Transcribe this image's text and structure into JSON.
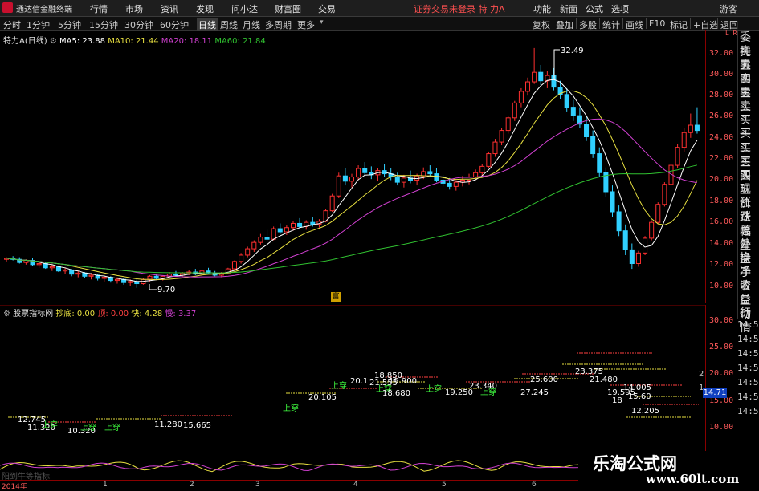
{
  "menubar": {
    "app_title": "通达信金融终端",
    "items": [
      "行情",
      "市场",
      "资讯",
      "发现",
      "问小达",
      "财富圈",
      "交易"
    ],
    "login_status": "证券交易未登录 特 力A",
    "right_items": [
      "功能",
      "新面",
      "公式",
      "选项"
    ],
    "guest": "游客"
  },
  "toolbar": {
    "periods": [
      "分时",
      "1分钟",
      "5分钟",
      "15分钟",
      "30分钟",
      "60分钟",
      "日线",
      "周线",
      "月线",
      "多周期",
      "更多"
    ],
    "active_period": "日线",
    "right_items": [
      "复权",
      "叠加",
      "多股",
      "统计",
      "画线",
      "F10",
      "标记",
      "+自选",
      "返回"
    ]
  },
  "main_legend": {
    "name": "特力A(日线)",
    "ma5": "MA5: 23.88",
    "ma10": "MA10: 21.44",
    "ma20": "MA20: 18.11",
    "ma60": "MA60: 21.84"
  },
  "main_annotations": {
    "high": "32.49",
    "low": "9.70",
    "fuq": "富"
  },
  "ind_legend": {
    "name": "股票指标网",
    "chaodi": "抄底: 0.00",
    "ding": "顶: 0.00",
    "kuai": "快: 4.28",
    "man": "慢: 3.37"
  },
  "ind_annotations": [
    {
      "t": "12.745",
      "c": "#ffffff"
    },
    {
      "t": "11.320",
      "c": "#ffffff"
    },
    {
      "t": "10.320",
      "c": "#ffffff"
    },
    {
      "t": "上穿",
      "c": "#40ff40"
    },
    {
      "t": "上穿",
      "c": "#40ff40"
    },
    {
      "t": "上穿",
      "c": "#40ff40"
    },
    {
      "t": "11.280",
      "c": "#ffffff"
    },
    {
      "t": "15.665",
      "c": "#ffffff"
    },
    {
      "t": "上穿",
      "c": "#40ff40"
    },
    {
      "t": "20.105",
      "c": "#ffffff"
    },
    {
      "t": "上穿",
      "c": "#40ff40"
    },
    {
      "t": "20.1",
      "c": "#ffffff"
    },
    {
      "t": "21.555",
      "c": "#ffffff"
    },
    {
      "t": "19.900",
      "c": "#ffffff"
    },
    {
      "t": "18.850",
      "c": "#ffffff"
    },
    {
      "t": "上穿",
      "c": "#40ff40"
    },
    {
      "t": "18.680",
      "c": "#ffffff"
    },
    {
      "t": "上穿",
      "c": "#40ff40"
    },
    {
      "t": "19.250",
      "c": "#ffffff"
    },
    {
      "t": "23.340",
      "c": "#ffffff"
    },
    {
      "t": "上穿",
      "c": "#40ff40"
    },
    {
      "t": "27.245",
      "c": "#ffffff"
    },
    {
      "t": "25.600",
      "c": "#ffffff"
    },
    {
      "t": "23.375",
      "c": "#ffffff"
    },
    {
      "t": "21.480",
      "c": "#ffffff"
    },
    {
      "t": "19.595",
      "c": "#ffffff"
    },
    {
      "t": "18",
      "c": "#ffffff"
    },
    {
      "t": "14.005",
      "c": "#ffffff"
    },
    {
      "t": "15.60",
      "c": "#ffffff"
    },
    {
      "t": "12.205",
      "c": "#ffffff"
    }
  ],
  "axis_main": [
    "32.00",
    "30.00",
    "28.00",
    "26.00",
    "24.00",
    "22.00",
    "20.00",
    "18.00",
    "16.00",
    "14.00",
    "12.00",
    "10.00"
  ],
  "axis_ind": [
    "30.00",
    "25.00",
    "20.00",
    "15.00",
    "10.00"
  ],
  "axis_top_corner": "L R",
  "current_price": "14.71",
  "ind_corner": [
    "2",
    "1"
  ],
  "side_panel": [
    "委托",
    "卖五",
    "卖四",
    "卖三",
    "卖二",
    "卖一",
    "买一",
    "买二",
    "买三",
    "买四",
    "买五",
    "现价",
    "涨跌",
    "涨幅",
    "总量",
    "外盘",
    "换手",
    "净资",
    "收益",
    "自动",
    "行情"
  ],
  "time_panel": [
    "14:55",
    "14:55",
    "14:56",
    "14:56",
    "14:56",
    "14:56",
    "14:57"
  ],
  "x_axis": [
    "2014年",
    "1",
    "2",
    "3",
    "4",
    "5",
    "6"
  ],
  "bottom_label": "阳到牛等指标",
  "watermark": {
    "title": "乐淘公式网",
    "url": "www.60lt.com"
  },
  "colors": {
    "up": "#ff3030",
    "down": "#30d0ff",
    "ma5": "#ffffff",
    "ma10": "#e8e040",
    "ma20": "#d040d0",
    "ma60": "#30c030",
    "bg": "#000000"
  },
  "chart_data": {
    "type": "candlestick",
    "ylim": [
      9,
      33
    ],
    "candles": [
      [
        12.4,
        12.6,
        12.2,
        12.5
      ],
      [
        12.5,
        12.7,
        12.3,
        12.4
      ],
      [
        12.4,
        12.6,
        12.0,
        12.1
      ],
      [
        12.1,
        12.4,
        11.9,
        12.3
      ],
      [
        12.3,
        12.5,
        11.8,
        11.9
      ],
      [
        11.9,
        12.2,
        11.6,
        12.0
      ],
      [
        12.0,
        12.1,
        11.5,
        11.6
      ],
      [
        11.6,
        11.9,
        11.3,
        11.7
      ],
      [
        11.7,
        11.8,
        11.2,
        11.3
      ],
      [
        11.3,
        11.6,
        11.0,
        11.4
      ],
      [
        11.4,
        11.5,
        10.8,
        11.0
      ],
      [
        11.0,
        11.3,
        10.7,
        11.1
      ],
      [
        11.1,
        11.2,
        10.6,
        10.8
      ],
      [
        10.8,
        11.1,
        10.5,
        10.9
      ],
      [
        10.9,
        11.0,
        10.4,
        10.6
      ],
      [
        10.6,
        10.9,
        10.3,
        10.7
      ],
      [
        10.7,
        10.8,
        10.2,
        10.4
      ],
      [
        10.4,
        10.7,
        10.1,
        10.5
      ],
      [
        10.5,
        10.6,
        10.0,
        10.2
      ],
      [
        10.2,
        10.5,
        9.9,
        10.3
      ],
      [
        10.3,
        10.5,
        9.7,
        10.1
      ],
      [
        10.1,
        10.6,
        10.0,
        10.5
      ],
      [
        10.5,
        10.9,
        10.3,
        10.8
      ],
      [
        10.8,
        11.0,
        10.5,
        10.6
      ],
      [
        10.6,
        10.9,
        10.4,
        10.8
      ],
      [
        10.8,
        11.2,
        10.6,
        11.0
      ],
      [
        11.0,
        11.3,
        10.8,
        10.9
      ],
      [
        10.9,
        11.2,
        10.7,
        11.1
      ],
      [
        11.1,
        11.4,
        10.9,
        11.2
      ],
      [
        11.2,
        11.5,
        10.9,
        11.0
      ],
      [
        11.0,
        11.4,
        10.8,
        11.3
      ],
      [
        11.3,
        11.6,
        11.0,
        11.1
      ],
      [
        11.1,
        11.3,
        10.8,
        10.9
      ],
      [
        10.9,
        11.2,
        10.7,
        11.1
      ],
      [
        11.1,
        11.6,
        11.0,
        11.5
      ],
      [
        11.5,
        12.3,
        11.4,
        12.2
      ],
      [
        12.2,
        13.0,
        12.0,
        12.8
      ],
      [
        12.8,
        13.6,
        12.6,
        13.4
      ],
      [
        13.4,
        14.2,
        13.1,
        14.0
      ],
      [
        14.0,
        14.8,
        13.8,
        14.5
      ],
      [
        14.5,
        15.2,
        14.0,
        14.3
      ],
      [
        14.3,
        15.5,
        14.2,
        15.3
      ],
      [
        15.3,
        15.8,
        14.8,
        15.0
      ],
      [
        15.0,
        15.6,
        14.7,
        15.4
      ],
      [
        15.4,
        16.0,
        15.1,
        15.8
      ],
      [
        15.8,
        16.3,
        15.3,
        15.5
      ],
      [
        15.5,
        16.1,
        15.2,
        15.9
      ],
      [
        15.9,
        16.4,
        15.5,
        15.7
      ],
      [
        15.7,
        16.2,
        15.4,
        16.0
      ],
      [
        16.0,
        17.2,
        15.9,
        17.0
      ],
      [
        17.0,
        18.6,
        16.9,
        18.4
      ],
      [
        18.4,
        20.6,
        18.2,
        20.3
      ],
      [
        20.3,
        21.0,
        19.4,
        19.8
      ],
      [
        19.8,
        20.5,
        19.2,
        20.2
      ],
      [
        20.2,
        21.3,
        19.9,
        21.0
      ],
      [
        21.0,
        21.6,
        20.3,
        20.6
      ],
      [
        20.6,
        21.2,
        20.0,
        20.4
      ],
      [
        20.4,
        21.0,
        19.8,
        20.8
      ],
      [
        20.8,
        21.4,
        20.2,
        20.5
      ],
      [
        20.5,
        21.0,
        19.9,
        20.2
      ],
      [
        20.2,
        20.6,
        19.4,
        19.7
      ],
      [
        19.7,
        20.4,
        19.2,
        20.1
      ],
      [
        20.1,
        20.8,
        19.6,
        19.9
      ],
      [
        19.9,
        20.5,
        19.4,
        20.3
      ],
      [
        20.3,
        21.1,
        20.0,
        20.7
      ],
      [
        20.7,
        21.3,
        20.2,
        20.5
      ],
      [
        20.5,
        21.0,
        19.7,
        19.9
      ],
      [
        19.9,
        20.4,
        19.3,
        19.6
      ],
      [
        19.6,
        20.1,
        19.0,
        19.3
      ],
      [
        19.3,
        19.9,
        18.9,
        19.7
      ],
      [
        19.7,
        20.3,
        19.3,
        19.9
      ],
      [
        19.9,
        20.5,
        19.5,
        20.2
      ],
      [
        20.2,
        20.9,
        19.9,
        20.6
      ],
      [
        20.6,
        21.4,
        20.3,
        21.2
      ],
      [
        21.2,
        22.6,
        21.0,
        22.4
      ],
      [
        22.4,
        23.8,
        22.1,
        23.5
      ],
      [
        23.5,
        24.8,
        23.2,
        24.6
      ],
      [
        24.6,
        26.0,
        24.3,
        25.8
      ],
      [
        25.8,
        27.4,
        25.5,
        27.2
      ],
      [
        27.2,
        28.6,
        26.8,
        28.3
      ],
      [
        28.3,
        29.6,
        27.9,
        29.2
      ],
      [
        29.2,
        32.4,
        29.0,
        30.1
      ],
      [
        30.1,
        30.8,
        28.9,
        29.3
      ],
      [
        29.3,
        30.2,
        28.6,
        29.8
      ],
      [
        29.8,
        30.5,
        28.4,
        28.7
      ],
      [
        28.7,
        29.3,
        27.6,
        28.0
      ],
      [
        28.0,
        28.6,
        26.4,
        26.8
      ],
      [
        26.8,
        27.5,
        25.5,
        26.0
      ],
      [
        26.0,
        26.8,
        24.8,
        25.2
      ],
      [
        25.2,
        25.9,
        23.6,
        24.0
      ],
      [
        24.0,
        24.6,
        22.0,
        22.4
      ],
      [
        22.4,
        23.0,
        20.2,
        20.6
      ],
      [
        20.6,
        21.1,
        18.3,
        18.8
      ],
      [
        18.8,
        19.4,
        16.4,
        16.9
      ],
      [
        16.9,
        17.5,
        14.6,
        15.1
      ],
      [
        15.1,
        15.7,
        12.8,
        13.3
      ],
      [
        13.3,
        13.9,
        11.5,
        12.0
      ],
      [
        12.0,
        13.2,
        11.7,
        13.0
      ],
      [
        13.0,
        14.6,
        12.8,
        14.4
      ],
      [
        14.4,
        16.1,
        14.2,
        15.9
      ],
      [
        15.9,
        17.8,
        15.7,
        17.6
      ],
      [
        17.6,
        19.7,
        17.4,
        19.5
      ],
      [
        19.5,
        21.6,
        19.3,
        21.3
      ],
      [
        21.3,
        23.3,
        21.0,
        23.0
      ],
      [
        23.0,
        24.8,
        22.6,
        24.4
      ],
      [
        24.4,
        26.2,
        23.9,
        25.1
      ],
      [
        25.1,
        26.8,
        24.3,
        24.6
      ]
    ],
    "lines": [
      "ma5",
      "ma10",
      "ma20",
      "ma60"
    ]
  }
}
